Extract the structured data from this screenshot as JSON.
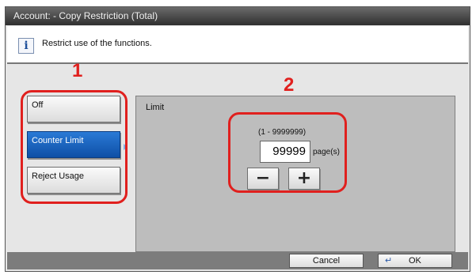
{
  "window": {
    "title": "Account:  - Copy Restriction (Total)"
  },
  "message": {
    "icon": "info-icon",
    "glyph": "i",
    "text": "Restrict use of the functions."
  },
  "annotations": {
    "left": "1",
    "right": "2",
    "color": "#e0201e"
  },
  "options": [
    {
      "label": "Off",
      "selected": false
    },
    {
      "label": "Counter Limit",
      "selected": true
    },
    {
      "label": "Reject Usage",
      "selected": false
    }
  ],
  "limit_panel": {
    "title": "Limit",
    "range": "(1 - 9999999)",
    "value": "99999",
    "unit": "page(s)",
    "minus_glyph": "−",
    "plus_glyph": "+"
  },
  "footer": {
    "cancel_label": "Cancel",
    "ok_icon_glyph": "↵",
    "ok_label": "OK"
  },
  "colors": {
    "selected_button": "#0e4fa6",
    "titlebar": "#2f2f2f",
    "panel": "#bdbdbd",
    "annotation": "#e0201e"
  }
}
